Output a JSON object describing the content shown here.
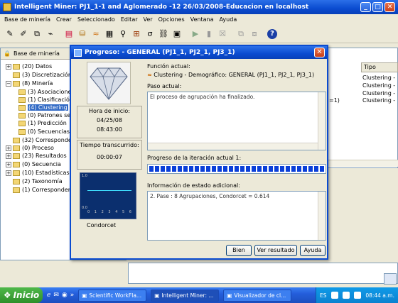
{
  "main_window": {
    "title": "Intelligent Miner: PJ1_1-1 and Aglomerado -12 26/03/2008-Educacion en localhost",
    "minimize": "_",
    "maximize": "□",
    "close": "✕"
  },
  "menu": [
    "Base de minería",
    "Crear",
    "Seleccionado",
    "Editar",
    "Ver",
    "Opciones",
    "Ventana",
    "Ayuda"
  ],
  "toolbar": {
    "help": "?"
  },
  "tree": {
    "header": "Base de minería",
    "items": [
      {
        "label": "(20) Datos",
        "exp": "+"
      },
      {
        "label": "(3) Discretización",
        "exp": ""
      },
      {
        "label": "(8) Minería",
        "exp": "−"
      },
      {
        "label": "(3) Asociaciones",
        "exp": ""
      },
      {
        "label": "(1) Clasificación",
        "exp": ""
      },
      {
        "label": "(4) Clustering",
        "exp": ""
      },
      {
        "label": "(0) Patrones se",
        "exp": ""
      },
      {
        "label": "(1) Predicción",
        "exp": ""
      },
      {
        "label": "(0) Secuencias",
        "exp": ""
      },
      {
        "label": "(32) Corresponde",
        "exp": ""
      },
      {
        "label": "(0) Proceso",
        "exp": "+"
      },
      {
        "label": "(23) Resultados",
        "exp": "+"
      },
      {
        "label": "(0) Secuencia",
        "exp": "+"
      },
      {
        "label": "(10) Estadísticas",
        "exp": "+"
      },
      {
        "label": "(2) Taxonomía",
        "exp": ""
      },
      {
        "label": "(1) Corresponden",
        "exp": ""
      }
    ]
  },
  "list": {
    "col_tipo": "Tipo",
    "rows": [
      "Clustering -",
      "Clustering -",
      "Clustering -",
      "Clustering -"
    ],
    "peek": "=1)"
  },
  "dialog": {
    "title": "Progreso: - GENERAL (PJ1_1, PJ2_1, PJ3_1)",
    "close": "✕",
    "funcion_label": "Función actual:",
    "funcion_value": "Clustering - Demográfico: GENERAL (PJ1_1, PJ2_1, PJ3_1)",
    "paso_label": "Paso actual:",
    "paso_text": "El proceso de agrupación ha finalizado.",
    "hora_label": "Hora de inicio:",
    "hora_date": "04/25/08",
    "hora_time": "08:43:00",
    "tiempo_label": "Tiempo transcurrido:",
    "tiempo_value": "00:00:07",
    "chart_label": "Condorcet",
    "chart_axis": [
      "0",
      "1",
      "2",
      "3",
      "4",
      "5",
      "6"
    ],
    "chart_y_top": "1.0",
    "chart_y_bottom": "0.0",
    "progreso_label": "Progreso de la iteración actual 1:",
    "progress_fraction": 1.0,
    "estado_label": "Información de estado adicional:",
    "estado_text": "2. Pase : 8 Agrupaciones, Condorcet = 0.614",
    "btn_bien": "Bien",
    "btn_ver": "Ver resultado",
    "btn_ayuda": "Ayuda"
  },
  "taskbar": {
    "start": "Inicio",
    "quicklaunch_more": "»",
    "tasks": [
      "Scientific WorkFla...",
      "Intelligent Miner: ...",
      "Visualizador de cl..."
    ],
    "lang": "ES",
    "clock": "08:44 a.m."
  }
}
